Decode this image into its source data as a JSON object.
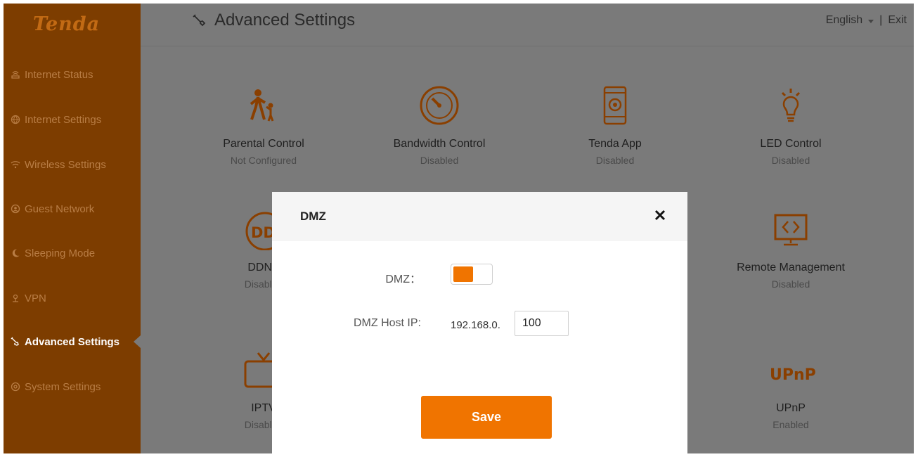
{
  "app": {
    "logo": "Tenda"
  },
  "sidebar": {
    "items": [
      {
        "label": "Internet Status",
        "icon": "router-icon"
      },
      {
        "label": "Internet Settings",
        "icon": "globe-icon"
      },
      {
        "label": "Wireless Settings",
        "icon": "wifi-icon"
      },
      {
        "label": "Guest Network",
        "icon": "guest-icon"
      },
      {
        "label": "Sleeping Mode",
        "icon": "moon-icon"
      },
      {
        "label": "VPN",
        "icon": "vpn-icon"
      },
      {
        "label": "Advanced Settings",
        "icon": "wrench-icon",
        "active": true
      },
      {
        "label": "System Settings",
        "icon": "gear-icon"
      }
    ]
  },
  "header": {
    "title": "Advanced Settings",
    "language": "English",
    "separator": "|",
    "exit": "Exit"
  },
  "tiles": [
    {
      "label": "Parental Control",
      "status": "Not Configured",
      "icon": "parental-icon"
    },
    {
      "label": "Bandwidth Control",
      "status": "Disabled",
      "icon": "gauge-icon"
    },
    {
      "label": "Tenda App",
      "status": "Disabled",
      "icon": "tablet-gear-icon"
    },
    {
      "label": "LED Control",
      "status": "Disabled",
      "icon": "bulb-icon"
    },
    {
      "label": "DDNS",
      "status": "Disabled",
      "icon": "ddns-icon"
    },
    {
      "label": "Remote Management",
      "status": "Disabled",
      "icon": "monitor-code-icon"
    },
    {
      "label": "IPTV",
      "status": "Disabled",
      "icon": "tv-icon"
    },
    {
      "label": "UPnP",
      "status": "Enabled",
      "icon": "upnp-icon"
    }
  ],
  "modal": {
    "title": "DMZ",
    "dmz_label": "DMZ：",
    "dmz_enabled": true,
    "host_ip_label": "DMZ Host IP:",
    "ip_prefix": "192.168.0.",
    "ip_last_octet": "100",
    "save_label": "Save",
    "ddns_icon_text": "DDN",
    "upnp_icon_text": "UPnP"
  },
  "colors": {
    "sidebar_bg": "#7d3d00",
    "accent": "#f07400",
    "overlay": "#7a7a7a"
  }
}
